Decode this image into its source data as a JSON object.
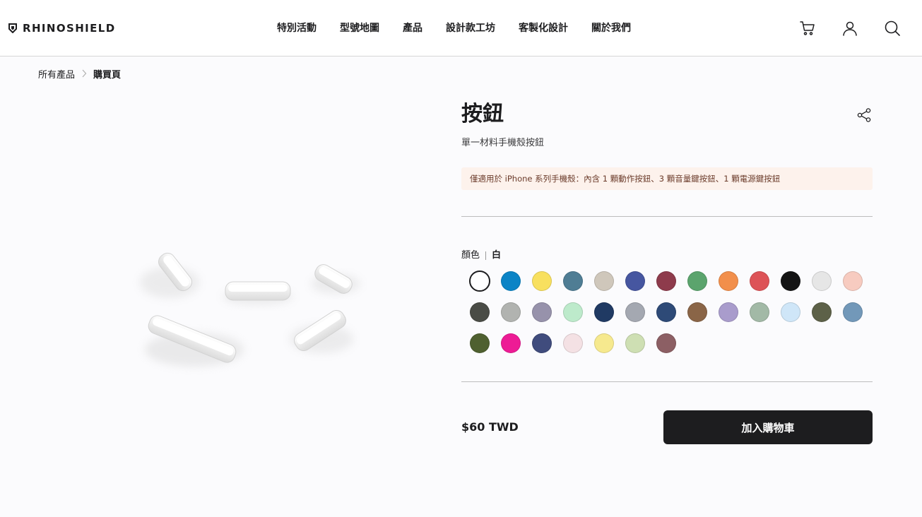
{
  "header": {
    "logo_text": "RHINOSHIELD",
    "nav": [
      {
        "label": "特別活動",
        "name": "nav-item-events"
      },
      {
        "label": "型號地圖",
        "name": "nav-item-model-map"
      },
      {
        "label": "產品",
        "name": "nav-item-products"
      },
      {
        "label": "設計款工坊",
        "name": "nav-item-design-studio"
      },
      {
        "label": "客製化設計",
        "name": "nav-item-customize"
      },
      {
        "label": "關於我們",
        "name": "nav-item-about"
      }
    ],
    "icons": [
      "cart-icon",
      "user-icon",
      "search-icon"
    ]
  },
  "breadcrumb": {
    "items": [
      "所有產品",
      "購買頁"
    ]
  },
  "product": {
    "title": "按鈕",
    "subtitle": "單一材料手機殼按鈕",
    "notice": "僅適用於 iPhone 系列手機殼：內含 1 顆動作按鈕、3 顆音量鍵按鈕、1 顆電源鍵按鈕",
    "color_label": "顏色",
    "selected_color": "白",
    "price": "$60 TWD",
    "add_to_cart_label": "加入購物車"
  },
  "colors": {
    "swatches": [
      "#ffffff",
      "#0b84c6",
      "#f8e05f",
      "#4f7d94",
      "#cfc7bb",
      "#4656a0",
      "#8e3b4c",
      "#5ba46d",
      "#f28f4b",
      "#dd5357",
      "#141414",
      "#e6e6e6",
      "#f7cbc0",
      "#4a4c46",
      "#b1b3b0",
      "#9792ab",
      "#bdeacb",
      "#203a63",
      "#a4a8b1",
      "#2e4a77",
      "#8a6547",
      "#a99ccc",
      "#a2b9a6",
      "#cfe6f8",
      "#5d6148",
      "#7298b9",
      "#4f6030",
      "#ed1b95",
      "#404c7d",
      "#f4e1e4",
      "#f6e98e",
      "#cedfb3",
      "#8c5f64"
    ],
    "selected_index": 0
  }
}
